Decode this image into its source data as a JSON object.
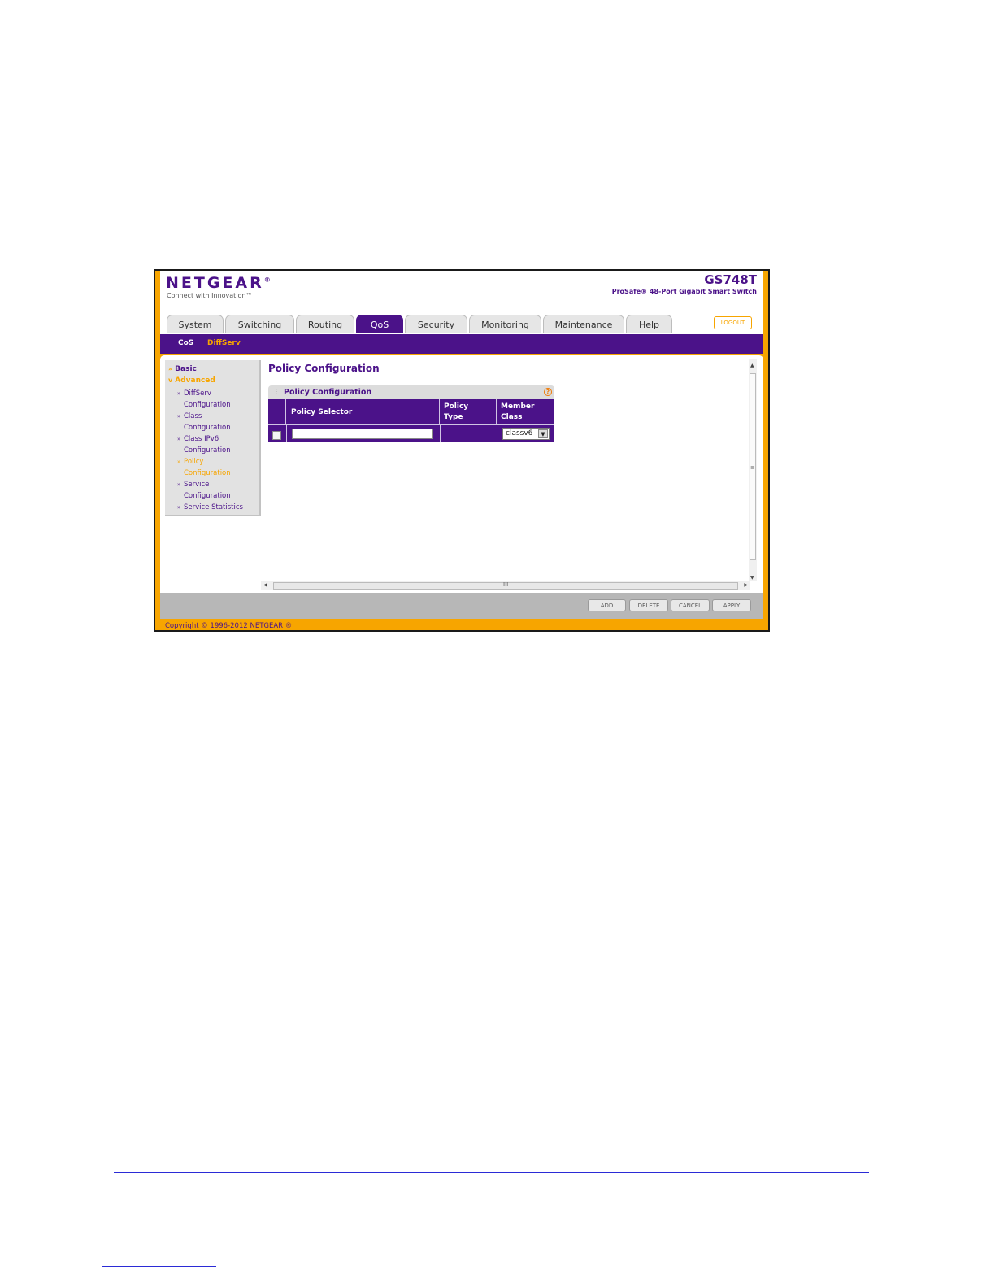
{
  "brand": {
    "logo": "NETGEAR",
    "logo_mark": "®",
    "tagline": "Connect with Innovation™",
    "model": "GS748T",
    "model_desc": "ProSafe® 48-Port Gigabit Smart Switch",
    "logout": "LOGOUT"
  },
  "tabs": [
    "System",
    "Switching",
    "Routing",
    "QoS",
    "Security",
    "Monitoring",
    "Maintenance",
    "Help"
  ],
  "active_tab": "QoS",
  "subnav": {
    "cos": "CoS",
    "separator": "|",
    "diffserv": "DiffServ"
  },
  "leftnav": {
    "basic": "Basic",
    "advanced": "Advanced",
    "items": [
      {
        "line1": "DiffServ",
        "line2": "Configuration"
      },
      {
        "line1": "Class",
        "line2": "Configuration"
      },
      {
        "line1": "Class IPv6",
        "line2": "Configuration"
      },
      {
        "line1": "Policy",
        "line2": "Configuration"
      },
      {
        "line1": "Service",
        "line2": "Configuration"
      },
      {
        "line1": "Service Statistics",
        "line2": ""
      }
    ],
    "active_item": "Policy Configuration"
  },
  "main": {
    "page_title": "Policy Configuration",
    "panel_title": "Policy Configuration",
    "columns": {
      "selector": "Policy Selector",
      "type_1": "Policy",
      "type_2": "Type",
      "member_1": "Member",
      "member_2": "Class"
    },
    "row": {
      "policy_selector": "",
      "policy_type": "",
      "member_class": "classv6"
    }
  },
  "buttons": {
    "add": "ADD",
    "delete": "DELETE",
    "cancel": "CANCEL",
    "apply": "APPLY"
  },
  "footer": {
    "copyright": "Copyright © 1996-2012 NETGEAR ®"
  },
  "colors": {
    "brand_purple": "#4b1289",
    "accent_orange": "#f7a500"
  }
}
